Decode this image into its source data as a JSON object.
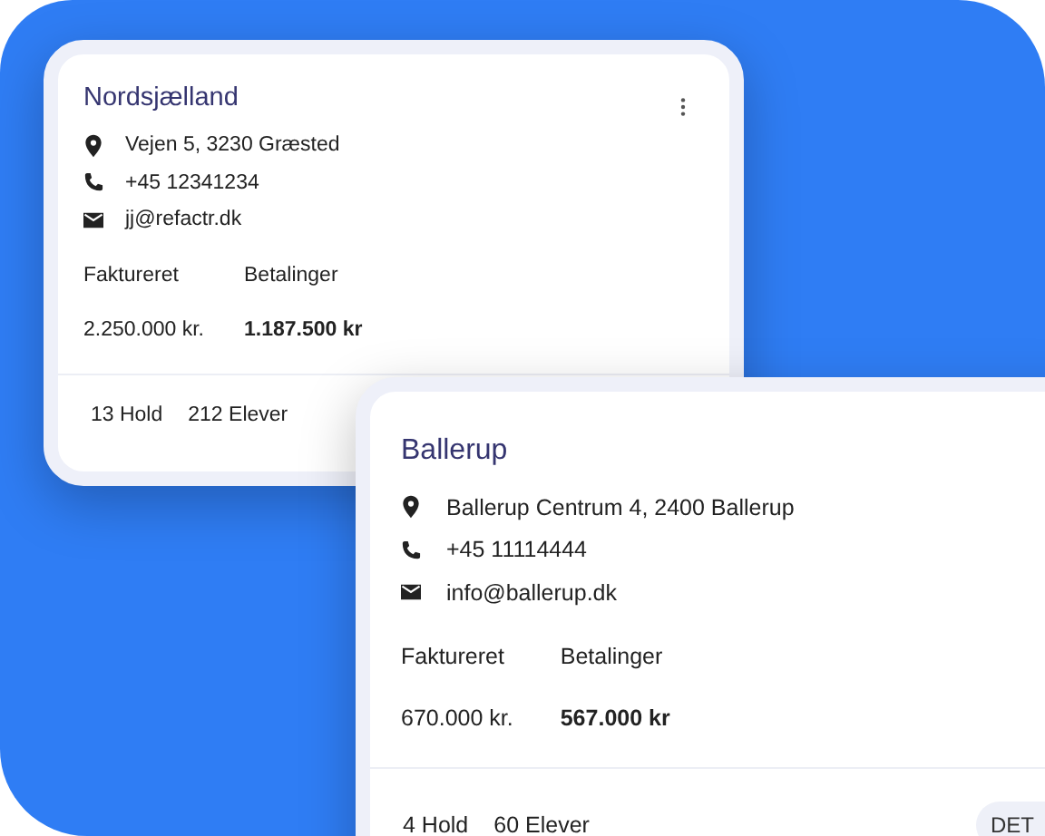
{
  "cards": [
    {
      "menu": true,
      "title": "Nordsjælland",
      "address": "Vejen 5, 3230 Græsted",
      "phone": "+45 12341234",
      "email": "jj@refactr.dk",
      "invoiced_label": "Faktureret",
      "payments_label": "Betalinger",
      "invoiced": "2.250.000 kr.",
      "payments": "1.187.500 kr",
      "teams": "13 Hold",
      "students": "212 Elever"
    },
    {
      "menu": false,
      "title": "Ballerup",
      "address": "Ballerup Centrum 4, 2400 Ballerup",
      "phone": "+45 11114444",
      "email": "info@ballerup.dk",
      "invoiced_label": "Faktureret",
      "payments_label": "Betalinger",
      "invoiced": "670.000 kr.",
      "payments": "567.000 kr",
      "teams": "4 Hold",
      "students": "60 Elever",
      "button": "DET"
    }
  ]
}
